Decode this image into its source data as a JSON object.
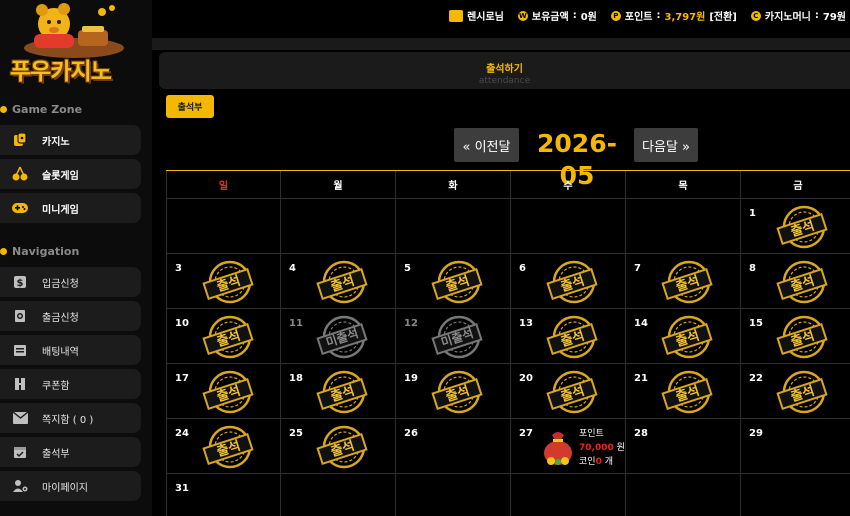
{
  "brand": {
    "logo_text": "푸우카지노"
  },
  "topbar": {
    "username": "렌시로님",
    "balance_label": "보유금액",
    "balance_value": "0원",
    "points_label": "포인트",
    "points_value": "3,797원",
    "convert_label": "[전환]",
    "casino_money_label": "카지노머니",
    "casino_money_value": "79원"
  },
  "sidebar": {
    "game_zone_title": "Game Zone",
    "game_items": [
      {
        "label": "카지노",
        "icon": "casino-icon"
      },
      {
        "label": "슬롯게임",
        "icon": "cherry-icon"
      },
      {
        "label": "미니게임",
        "icon": "gamepad-icon"
      }
    ],
    "navigation_title": "Navigation",
    "nav_items": [
      {
        "label": "입금신청",
        "icon": "deposit-icon"
      },
      {
        "label": "출금신청",
        "icon": "withdraw-icon"
      },
      {
        "label": "배팅내역",
        "icon": "history-icon"
      },
      {
        "label": "쿠폰함",
        "icon": "coupon-icon"
      },
      {
        "label": "쪽지함 ( 0 )",
        "icon": "mail-icon"
      },
      {
        "label": "출석부",
        "icon": "calendar-check-icon"
      },
      {
        "label": "마이페이지",
        "icon": "user-gear-icon"
      }
    ]
  },
  "page": {
    "title": "출석하기",
    "subtitle": "attendance",
    "attendance_button": "출석부",
    "prev_label": "« 이전달",
    "next_label": "다음달 »",
    "month": "2026-05"
  },
  "calendar": {
    "weekdays": [
      "일",
      "월",
      "화",
      "수",
      "목",
      "금"
    ],
    "stamp_attend": "출석",
    "stamp_missed": "미출석",
    "reward": {
      "title": "포인트",
      "amount": "70,000",
      "unit": "원",
      "coin_label": "코인",
      "coin_value": "0",
      "coin_unit": "개"
    },
    "weeks": [
      [
        {
          "day": "",
          "status": ""
        },
        {
          "day": "",
          "status": ""
        },
        {
          "day": "",
          "status": ""
        },
        {
          "day": "",
          "status": ""
        },
        {
          "day": "",
          "status": ""
        },
        {
          "day": "1",
          "status": "attend"
        }
      ],
      [
        {
          "day": "3",
          "status": "attend"
        },
        {
          "day": "4",
          "status": "attend"
        },
        {
          "day": "5",
          "status": "attend"
        },
        {
          "day": "6",
          "status": "attend"
        },
        {
          "day": "7",
          "status": "attend"
        },
        {
          "day": "8",
          "status": "attend"
        }
      ],
      [
        {
          "day": "10",
          "status": "attend"
        },
        {
          "day": "11",
          "status": "missed"
        },
        {
          "day": "12",
          "status": "missed"
        },
        {
          "day": "13",
          "status": "attend"
        },
        {
          "day": "14",
          "status": "attend"
        },
        {
          "day": "15",
          "status": "attend"
        }
      ],
      [
        {
          "day": "17",
          "status": "attend"
        },
        {
          "day": "18",
          "status": "attend"
        },
        {
          "day": "19",
          "status": "attend"
        },
        {
          "day": "20",
          "status": "attend"
        },
        {
          "day": "21",
          "status": "attend"
        },
        {
          "day": "22",
          "status": "attend"
        }
      ],
      [
        {
          "day": "24",
          "status": "attend"
        },
        {
          "day": "25",
          "status": "attend"
        },
        {
          "day": "26",
          "status": ""
        },
        {
          "day": "27",
          "status": "reward"
        },
        {
          "day": "28",
          "status": ""
        },
        {
          "day": "29",
          "status": ""
        }
      ],
      [
        {
          "day": "31",
          "status": ""
        },
        {
          "day": "",
          "status": ""
        },
        {
          "day": "",
          "status": ""
        },
        {
          "day": "",
          "status": ""
        },
        {
          "day": "",
          "status": ""
        },
        {
          "day": "",
          "status": ""
        }
      ]
    ]
  },
  "colors": {
    "accent": "#f5b800",
    "sunday": "#e53030",
    "reward_red": "#f51d1d"
  }
}
